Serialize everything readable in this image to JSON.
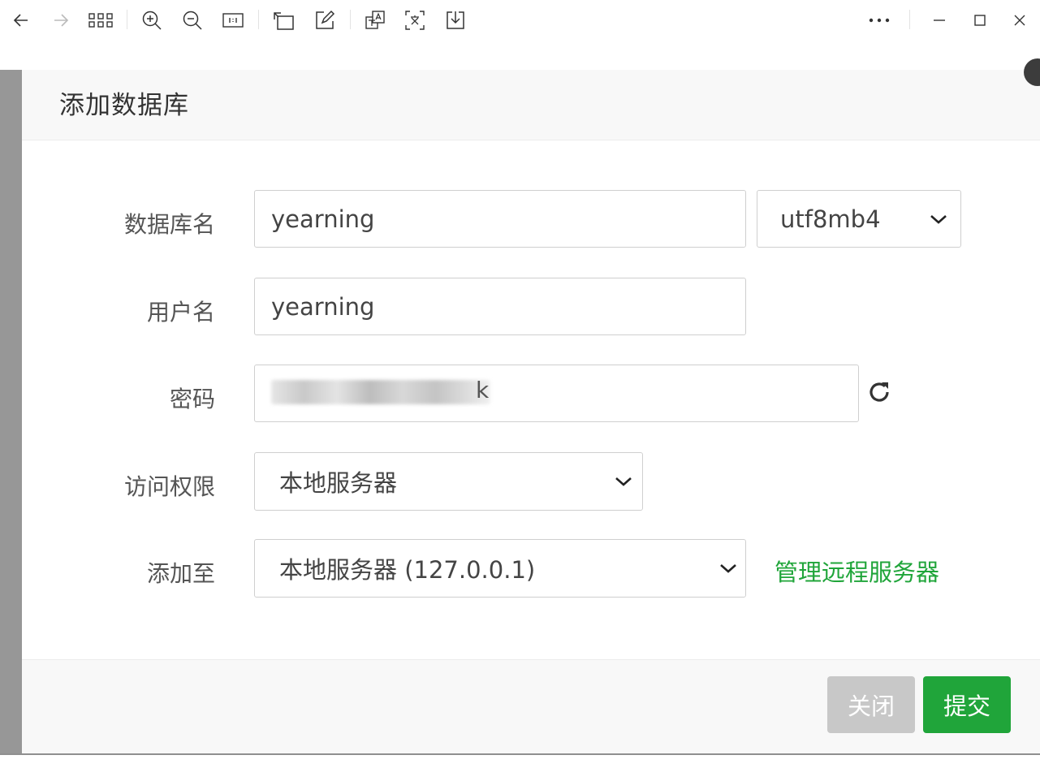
{
  "viewer_toolbar": {
    "icons": [
      "back-arrow-icon",
      "forward-arrow-icon",
      "grid-view-icon",
      "zoom-in-icon",
      "zoom-out-icon",
      "actual-size-icon",
      "rotate-icon",
      "edit-icon",
      "translate-image-icon",
      "text-recognition-icon",
      "download-icon",
      "more-icon",
      "minimize-icon",
      "maximize-icon",
      "close-window-icon"
    ]
  },
  "dialog": {
    "title": "添加数据库",
    "fields": {
      "db_name": {
        "label": "数据库名",
        "value": "yearning",
        "charset": "utf8mb4"
      },
      "username": {
        "label": "用户名",
        "value": "yearning"
      },
      "password": {
        "label": "密码",
        "visible_tail": "k"
      },
      "access": {
        "label": "访问权限",
        "value": "本地服务器"
      },
      "add_to": {
        "label": "添加至",
        "value": "本地服务器 (127.0.0.1)",
        "link": "管理远程服务器"
      }
    },
    "buttons": {
      "close": "关闭",
      "submit": "提交"
    }
  },
  "colors": {
    "accent": "#20a53a",
    "disabled_button": "#c8c8c8",
    "backdrop": "#9c9c9c"
  }
}
